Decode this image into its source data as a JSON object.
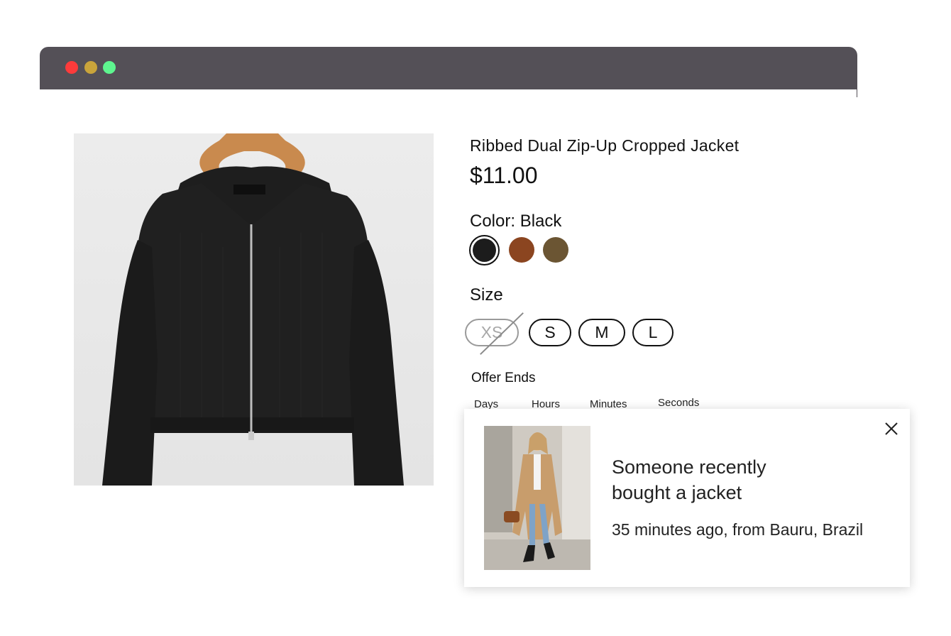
{
  "browser": {
    "dots": [
      {
        "name": "close",
        "color": "#fe3b3b"
      },
      {
        "name": "minimize",
        "color": "#c9a43b"
      },
      {
        "name": "maximize",
        "color": "#5ef58f"
      }
    ]
  },
  "product": {
    "title": "Ribbed Dual Zip-Up Cropped Jacket",
    "price": "$11.00",
    "color_label": "Color: Black",
    "colors": [
      {
        "name": "Black",
        "hex": "#1c1c1c",
        "selected": true
      },
      {
        "name": "Brown",
        "hex": "#8b4520",
        "selected": false
      },
      {
        "name": "Olive",
        "hex": "#6b5533",
        "selected": false
      }
    ],
    "size_label": "Size",
    "sizes": [
      {
        "label": "XS",
        "available": false
      },
      {
        "label": "S",
        "available": true
      },
      {
        "label": "M",
        "available": true
      },
      {
        "label": "L",
        "available": true
      }
    ],
    "image_icon": "black-zip-jacket-image"
  },
  "offer": {
    "label": "Offer Ends",
    "units": [
      "Days",
      "Hours",
      "Minutes",
      "Seconds"
    ]
  },
  "notification": {
    "title": "Someone recently bought a jacket",
    "subtitle": "35 minutes ago, from Bauru, Brazil",
    "image_icon": "woman-in-camel-coat-image",
    "close_icon": "close-icon"
  }
}
